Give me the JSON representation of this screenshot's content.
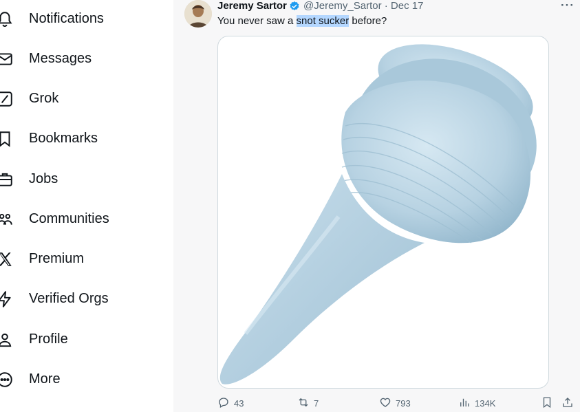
{
  "sidebar": {
    "items": [
      {
        "label": "Notifications",
        "icon": "bell-icon"
      },
      {
        "label": "Messages",
        "icon": "envelope-icon"
      },
      {
        "label": "Grok",
        "icon": "grok-icon"
      },
      {
        "label": "Bookmarks",
        "icon": "bookmark-icon"
      },
      {
        "label": "Jobs",
        "icon": "briefcase-icon"
      },
      {
        "label": "Communities",
        "icon": "people-icon"
      },
      {
        "label": "Premium",
        "icon": "x-logo-icon"
      },
      {
        "label": "Verified Orgs",
        "icon": "lightning-icon"
      },
      {
        "label": "Profile",
        "icon": "person-icon"
      },
      {
        "label": "More",
        "icon": "more-circle-icon"
      }
    ]
  },
  "tweet": {
    "author_name": "Jeremy Sartor",
    "handle_and_date": "@Jeremy_Sartor · Dec 17",
    "text_before": "You never saw a ",
    "text_highlight": "snot sucker",
    "text_after": " before?",
    "more": "···"
  },
  "actions": {
    "replies": "43",
    "reposts": "7",
    "likes": "793",
    "views": "134K"
  },
  "colors": {
    "accent": "#1d9bf0",
    "muted": "#536471",
    "highlight": "#b4d7ff",
    "bulb": "#b9d3e3"
  }
}
